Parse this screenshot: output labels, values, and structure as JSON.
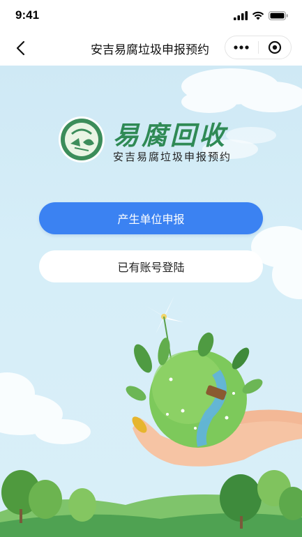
{
  "status_bar": {
    "time": "9:41"
  },
  "nav": {
    "title": "安吉易腐垃圾申报预约"
  },
  "logo": {
    "title": "易腐回收",
    "subtitle": "安吉易腐垃圾申报预约"
  },
  "actions": {
    "primary_label": "产生单位申报",
    "secondary_label": "已有账号登陆"
  },
  "colors": {
    "primary": "#3b82f2",
    "brand_green": "#2f8a55",
    "sky": "#d4ecf7"
  },
  "icons": [
    "signal-icon",
    "wifi-icon",
    "battery-icon",
    "back-icon",
    "more-icon",
    "close-circle-icon",
    "logo-emblem-icon"
  ]
}
